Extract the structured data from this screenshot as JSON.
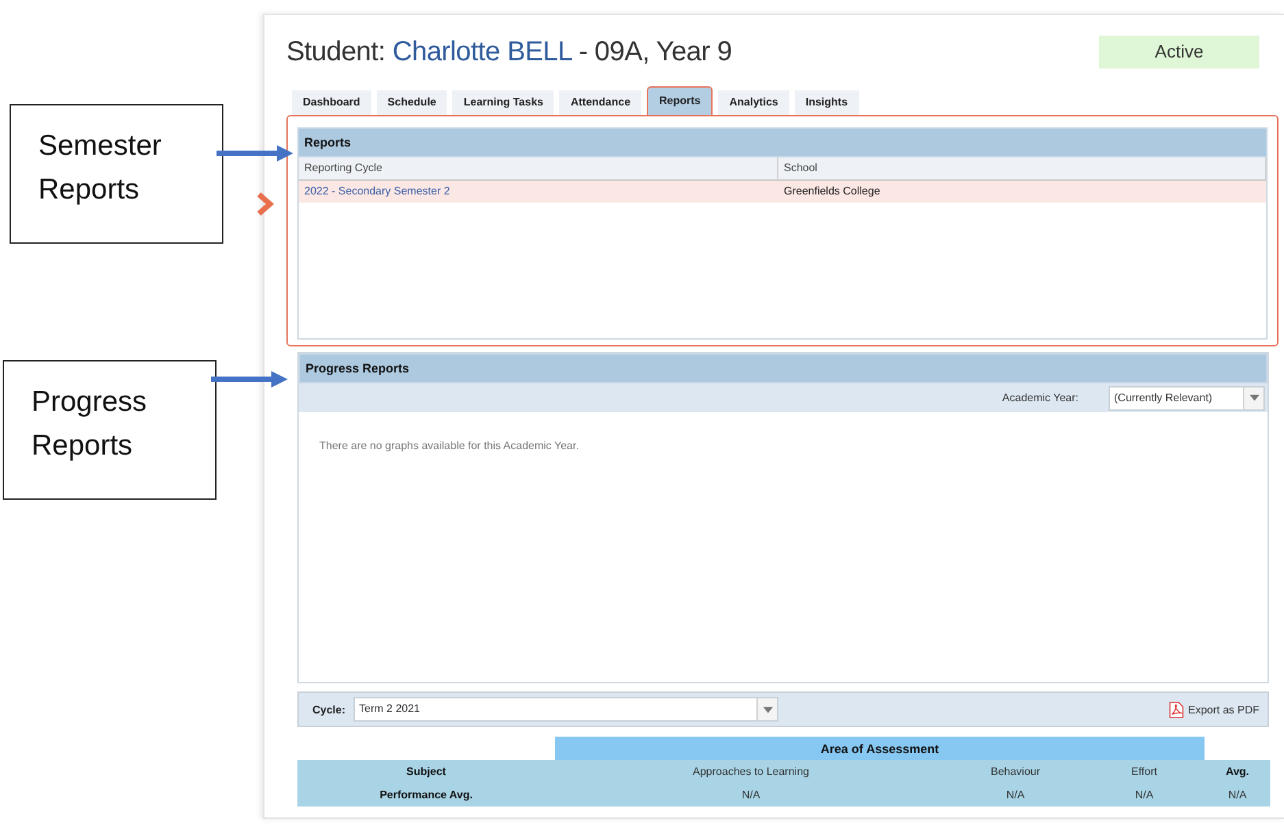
{
  "annotations": [
    {
      "label": "Semester Reports"
    },
    {
      "label": "Progress Reports"
    }
  ],
  "student": {
    "prefix": "Student:",
    "name": "Charlotte BELL",
    "suffix": "- 09A, Year 9",
    "status": "Active"
  },
  "tabs": [
    {
      "label": "Dashboard",
      "selected": false
    },
    {
      "label": "Schedule",
      "selected": false
    },
    {
      "label": "Learning Tasks",
      "selected": false
    },
    {
      "label": "Attendance",
      "selected": false
    },
    {
      "label": "Reports",
      "selected": true
    },
    {
      "label": "Analytics",
      "selected": false
    },
    {
      "label": "Insights",
      "selected": false
    }
  ],
  "reports": {
    "title": "Reports",
    "highlighted": true,
    "columns": [
      "Reporting Cycle",
      "School"
    ],
    "rows": [
      {
        "cells": [
          "2022 - Secondary Semester 2",
          "Greenfields College"
        ],
        "selected": true
      }
    ]
  },
  "progress_reports": {
    "title": "Progress Reports",
    "filter_label": "Academic Year:",
    "filter_value": "(Currently Relevant)",
    "message": "There are no graphs available for this Academic Year."
  },
  "cycle": {
    "label": "Cycle:",
    "value": "Term 2 2021",
    "export": "Export as PDF"
  },
  "assessment": {
    "group": "Area of Assessment",
    "columns": [
      "Subject",
      "Approaches to Learning",
      "Behaviour",
      "Effort",
      "Avg."
    ],
    "rows": [
      [
        "Performance Avg.",
        "N/A",
        "N/A",
        "N/A",
        "N/A"
      ]
    ]
  }
}
